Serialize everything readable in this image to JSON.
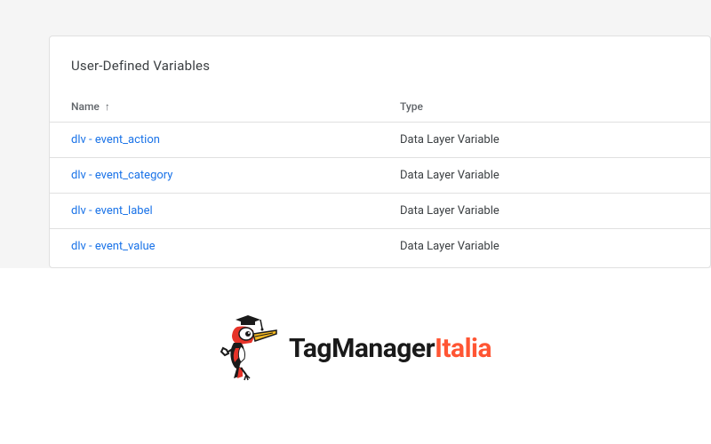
{
  "panel": {
    "title": "User-Defined Variables"
  },
  "table": {
    "columns": {
      "name": "Name",
      "type": "Type"
    },
    "rows": [
      {
        "name": "dlv - event_action",
        "type": "Data Layer Variable"
      },
      {
        "name": "dlv - event_category",
        "type": "Data Layer Variable"
      },
      {
        "name": "dlv - event_label",
        "type": "Data Layer Variable"
      },
      {
        "name": "dlv - event_value",
        "type": "Data Layer Variable"
      }
    ]
  },
  "logo": {
    "part1": "TagManager",
    "part2": "Italia"
  }
}
